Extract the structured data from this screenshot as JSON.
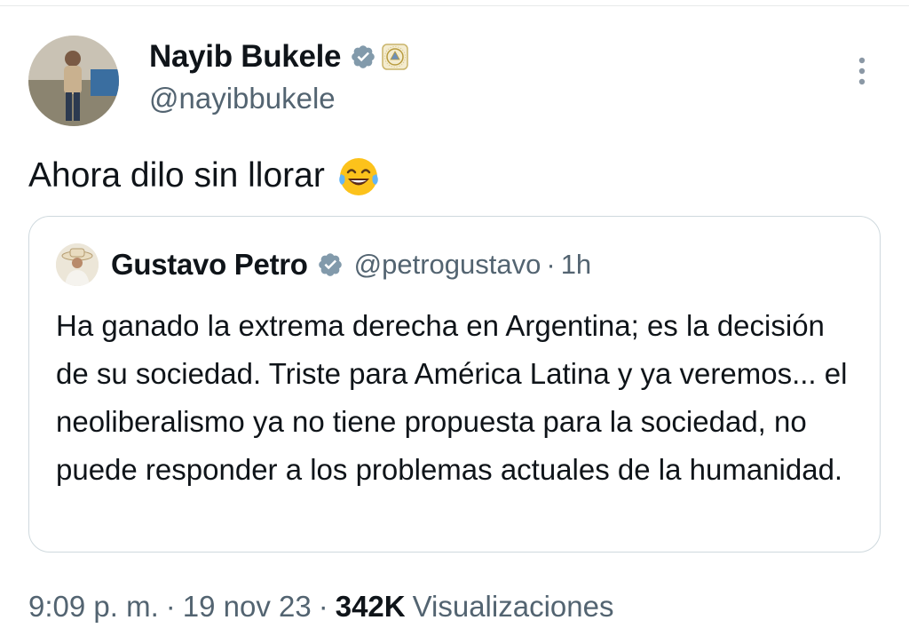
{
  "tweet": {
    "author": {
      "name": "Nayib Bukele",
      "handle": "@nayibbukele",
      "avatar_icon": "profile-photo-man-standing-outdoors",
      "verified_icon": "verified-badge-icon",
      "affiliation_icon": "el-salvador-coat-of-arms-icon"
    },
    "text": "Ahora dilo sin llorar",
    "emoji_icon": "face-with-tears-of-joy-icon",
    "quote": {
      "author_name": "Gustavo Petro",
      "author_handle": "@petrogustavo",
      "separator": "·",
      "time": "1h",
      "avatar_icon": "profile-photo-man-with-hat",
      "text": "Ha ganado la extrema derecha en Argentina; es la decisión de su sociedad. Triste para América Latina y ya veremos... el neoliberalismo ya no tiene propuesta para la sociedad, no puede responder a los problemas actuales de la humanidad."
    },
    "meta": {
      "time": "9:09 p. m.",
      "separator": "·",
      "date": "19 nov 23",
      "views_count": "342K",
      "views_label": "Visualizaciones"
    }
  },
  "colors": {
    "text_primary": "#0f1419",
    "text_secondary": "#536471",
    "verified_blue": "#829aab",
    "border": "#cfd9de"
  }
}
